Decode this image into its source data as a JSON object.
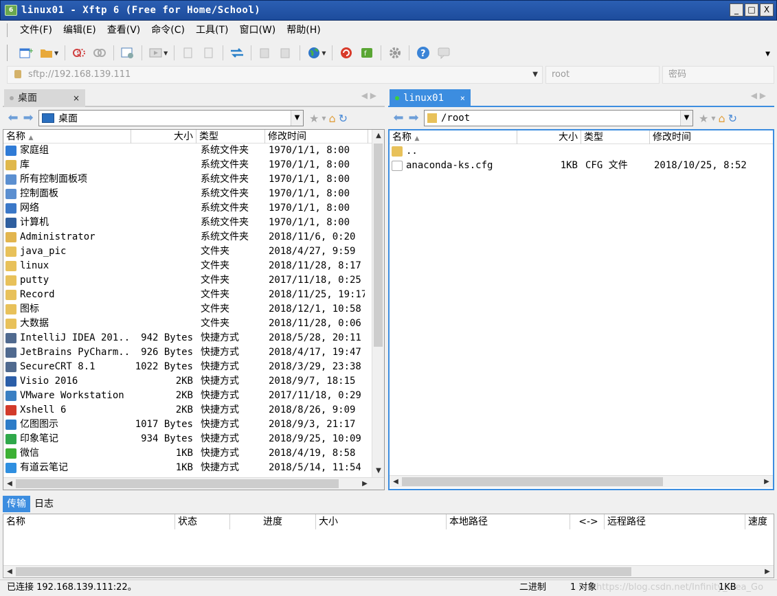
{
  "window": {
    "title": "linux01   - Xftp 6 (Free for Home/School)",
    "icon_label": "6",
    "min": "_",
    "max": "□",
    "close": "X"
  },
  "menu": [
    "文件(F)",
    "编辑(E)",
    "查看(V)",
    "命令(C)",
    "工具(T)",
    "窗口(W)",
    "帮助(H)"
  ],
  "toolbar_icons": [
    "new-session-icon",
    "open-folder-icon",
    "connect-icon",
    "disconnect-icon",
    "properties-icon",
    "play-icon",
    "copy-icon",
    "paste-icon",
    "sync-icon",
    "delete-icon",
    "rename-icon",
    "globe-icon",
    "xshell-icon",
    "xftp-icon",
    "settings-icon",
    "help-icon",
    "chat-icon"
  ],
  "address": {
    "url": "sftp://192.168.139.111",
    "user_placeholder": "root",
    "password_placeholder": "密码"
  },
  "left": {
    "tab_label": "桌面",
    "tab_close": "×",
    "path": "桌面",
    "columns": [
      "名称",
      "大小",
      "类型",
      "修改时间"
    ],
    "rows": [
      {
        "name": "家庭组",
        "size": "",
        "type": "系统文件夹",
        "mtime": "1970/1/1, 8:00",
        "icon": "homegroup-icon",
        "color": "#2f7bd6"
      },
      {
        "name": "库",
        "size": "",
        "type": "系统文件夹",
        "mtime": "1970/1/1, 8:00",
        "icon": "library-icon",
        "color": "#e0b84c"
      },
      {
        "name": "所有控制面板项",
        "size": "",
        "type": "系统文件夹",
        "mtime": "1970/1/1, 8:00",
        "icon": "control-panel-icon",
        "color": "#5b8fd0"
      },
      {
        "name": "控制面板",
        "size": "",
        "type": "系统文件夹",
        "mtime": "1970/1/1, 8:00",
        "icon": "control-panel-icon",
        "color": "#5b8fd0"
      },
      {
        "name": "网络",
        "size": "",
        "type": "系统文件夹",
        "mtime": "1970/1/1, 8:00",
        "icon": "network-icon",
        "color": "#3b78c8"
      },
      {
        "name": "计算机",
        "size": "",
        "type": "系统文件夹",
        "mtime": "1970/1/1, 8:00",
        "icon": "computer-icon",
        "color": "#2f5f9f"
      },
      {
        "name": "Administrator",
        "size": "",
        "type": "系统文件夹",
        "mtime": "2018/11/6, 0:20",
        "icon": "user-folder-icon",
        "color": "#e2b54e"
      },
      {
        "name": "java_pic",
        "size": "",
        "type": "文件夹",
        "mtime": "2018/4/27, 9:59",
        "icon": "folder-icon",
        "color": "#e8c15a"
      },
      {
        "name": "linux",
        "size": "",
        "type": "文件夹",
        "mtime": "2018/11/28, 8:17",
        "icon": "folder-icon",
        "color": "#e8c15a"
      },
      {
        "name": "putty",
        "size": "",
        "type": "文件夹",
        "mtime": "2017/11/18, 0:25",
        "icon": "folder-icon",
        "color": "#e8c15a"
      },
      {
        "name": "Record",
        "size": "",
        "type": "文件夹",
        "mtime": "2018/11/25, 19:17",
        "icon": "folder-icon",
        "color": "#e8c15a"
      },
      {
        "name": "图标",
        "size": "",
        "type": "文件夹",
        "mtime": "2018/12/1, 10:58",
        "icon": "folder-icon",
        "color": "#e8c15a"
      },
      {
        "name": "大数据",
        "size": "",
        "type": "文件夹",
        "mtime": "2018/11/28, 0:06",
        "icon": "folder-icon",
        "color": "#e8c15a"
      },
      {
        "name": "IntelliJ IDEA 201...",
        "size": "942 Bytes",
        "type": "快捷方式",
        "mtime": "2018/5/28, 20:11",
        "icon": "shortcut-icon",
        "color": "#506a8f"
      },
      {
        "name": "JetBrains PyCharm...",
        "size": "926 Bytes",
        "type": "快捷方式",
        "mtime": "2018/4/17, 19:47",
        "icon": "shortcut-icon",
        "color": "#506a8f"
      },
      {
        "name": "SecureCRT 8.1",
        "size": "1022 Bytes",
        "type": "快捷方式",
        "mtime": "2018/3/29, 23:38",
        "icon": "shortcut-icon",
        "color": "#506a8f"
      },
      {
        "name": "Visio 2016",
        "size": "2KB",
        "type": "快捷方式",
        "mtime": "2018/9/7, 18:15",
        "icon": "visio-icon",
        "color": "#2b5ea8"
      },
      {
        "name": "VMware Workstation",
        "size": "2KB",
        "type": "快捷方式",
        "mtime": "2017/11/18, 0:29",
        "icon": "vmware-icon",
        "color": "#3a7fc2"
      },
      {
        "name": "Xshell 6",
        "size": "2KB",
        "type": "快捷方式",
        "mtime": "2018/8/26, 9:09",
        "icon": "xshell-icon",
        "color": "#d23a2a"
      },
      {
        "name": "亿图图示",
        "size": "1017 Bytes",
        "type": "快捷方式",
        "mtime": "2018/9/3, 21:17",
        "icon": "edraw-icon",
        "color": "#2d7cc8"
      },
      {
        "name": "印象笔记",
        "size": "934 Bytes",
        "type": "快捷方式",
        "mtime": "2018/9/25, 10:09",
        "icon": "evernote-icon",
        "color": "#2fa84a"
      },
      {
        "name": "微信",
        "size": "1KB",
        "type": "快捷方式",
        "mtime": "2018/4/19, 8:58",
        "icon": "wechat-icon",
        "color": "#3cb034"
      },
      {
        "name": "有道云笔记",
        "size": "1KB",
        "type": "快捷方式",
        "mtime": "2018/5/14, 11:54",
        "icon": "youdao-icon",
        "color": "#2f8fe0"
      }
    ]
  },
  "right": {
    "tab_label": "linux01",
    "tab_close": "×",
    "path": "/root",
    "columns": [
      "名称",
      "大小",
      "类型",
      "修改时间"
    ],
    "rows": [
      {
        "name": "..",
        "size": "",
        "type": "",
        "mtime": "",
        "icon": "folder-icon",
        "color": "#e8c15a"
      },
      {
        "name": "anaconda-ks.cfg",
        "size": "1KB",
        "type": "CFG 文件",
        "mtime": "2018/10/25, 8:52",
        "icon": "file-icon",
        "color": "#ffffff"
      }
    ]
  },
  "bottom_tabs": [
    "传输",
    "日志"
  ],
  "transfer_columns": [
    "名称",
    "状态",
    "进度",
    "大小",
    "本地路径",
    "<->",
    "远程路径",
    "速度"
  ],
  "status": {
    "connection": "已连接 192.168.139.111:22。",
    "mode": "二进制",
    "objects": "1 对象",
    "size": "1KB",
    "watermark": "https://blog.csdn.net/Infinity_Idea_Go"
  }
}
